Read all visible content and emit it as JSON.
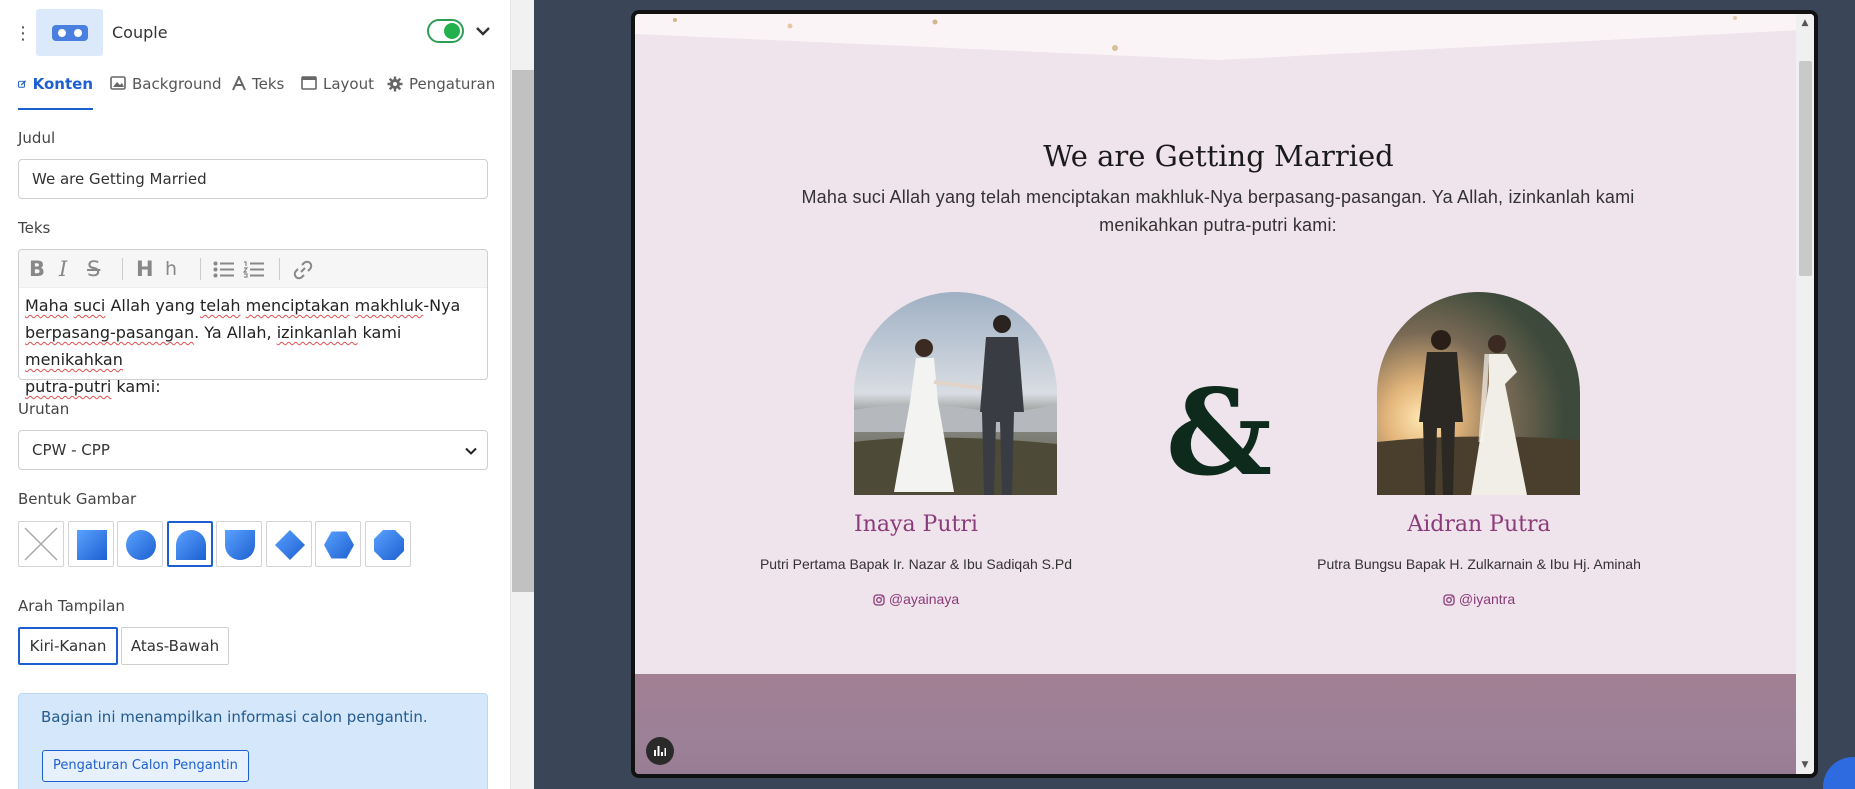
{
  "section": {
    "title": "Couple",
    "enabled": true
  },
  "tabs": [
    {
      "label": "Konten",
      "icon": "edit-icon",
      "active": true
    },
    {
      "label": "Background",
      "icon": "image-icon",
      "active": false
    },
    {
      "label": "Teks",
      "icon": "font-icon",
      "active": false
    },
    {
      "label": "Layout",
      "icon": "window-icon",
      "active": false
    },
    {
      "label": "Pengaturan",
      "icon": "gear-icon",
      "active": false
    }
  ],
  "form": {
    "judul_label": "Judul",
    "judul_value": "We are Getting Married",
    "teks_label": "Teks",
    "teks_lines": [
      [
        "Maha",
        " ",
        "suci",
        " Allah yang ",
        "telah",
        " ",
        "menciptakan",
        " ",
        "makhluk",
        "-Nya"
      ],
      [
        "berpasang-pasangan",
        ". Ya Allah, ",
        "izinkanlah",
        " kami ",
        "menikahkan"
      ],
      [
        "putra-putri",
        " kami:"
      ]
    ],
    "urutan_label": "Urutan",
    "urutan_value": "CPW - CPP",
    "bentuk_label": "Bentuk Gambar",
    "shapes": [
      "none",
      "square",
      "circle",
      "arch",
      "shield",
      "diamond",
      "hexagon",
      "octagon"
    ],
    "shape_selected": "arch",
    "arah_label": "Arah Tampilan",
    "arah_options": [
      "Kiri-Kanan",
      "Atas-Bawah"
    ],
    "arah_selected": "Kiri-Kanan",
    "info_text": "Bagian ini menampilkan informasi calon pengantin.",
    "info_button": "Pengaturan Calon Pengantin"
  },
  "preview": {
    "title": "We are Getting Married",
    "text": "Maha suci Allah yang telah menciptakan makhluk-Nya berpasang-pasangan. Ya Allah, izinkanlah kami menikahkan putra-putri kami:",
    "ampersand": "&",
    "bride": {
      "name": "Inaya Putri",
      "desc": "Putri Pertama Bapak Ir. Nazar & Ibu Sadiqah S.Pd",
      "instagram": "@ayainaya"
    },
    "groom": {
      "name": "Aidran Putra",
      "desc": "Putra Bungsu Bapak H. Zulkarnain & Ibu Hj. Aminah",
      "instagram": "@iyantra"
    }
  },
  "colors": {
    "accent": "#1d5fd0",
    "toggle_on": "#22b14c",
    "preview_bg": "#efe3ec",
    "name_color": "#8a3b79",
    "ampersand": "#0d2a1d"
  }
}
